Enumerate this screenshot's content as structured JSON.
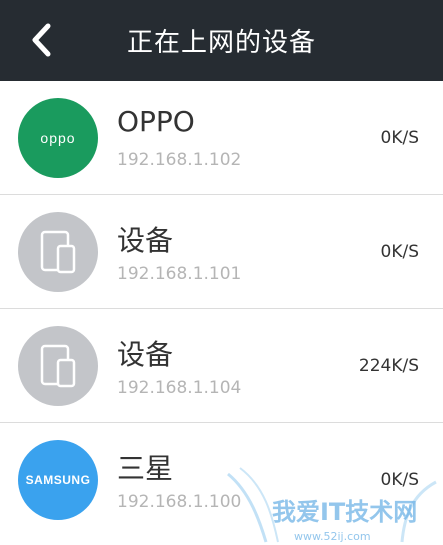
{
  "header": {
    "title": "正在上网的设备"
  },
  "devices": [
    {
      "name": "OPPO",
      "ip": "192.168.1.102",
      "speed": "0K/S",
      "icon": "oppo-logo",
      "brand_text": "oppo"
    },
    {
      "name": "设备",
      "ip": "192.168.1.101",
      "speed": "0K/S",
      "icon": "tablet-phone-icon"
    },
    {
      "name": "设备",
      "ip": "192.168.1.104",
      "speed": "224K/S",
      "icon": "tablet-phone-icon"
    },
    {
      "name": "三星",
      "ip": "192.168.1.100",
      "speed": "0K/S",
      "icon": "samsung-logo",
      "brand_text": "SAMSUNG"
    }
  ],
  "watermark": {
    "text": "我爱IT技术网",
    "url": "www.52ij.com"
  },
  "colors": {
    "header_bg": "#262c32",
    "oppo_green": "#1a9b5e",
    "samsung_blue": "#3aa2ee",
    "generic_gray": "#c3c5c9"
  }
}
